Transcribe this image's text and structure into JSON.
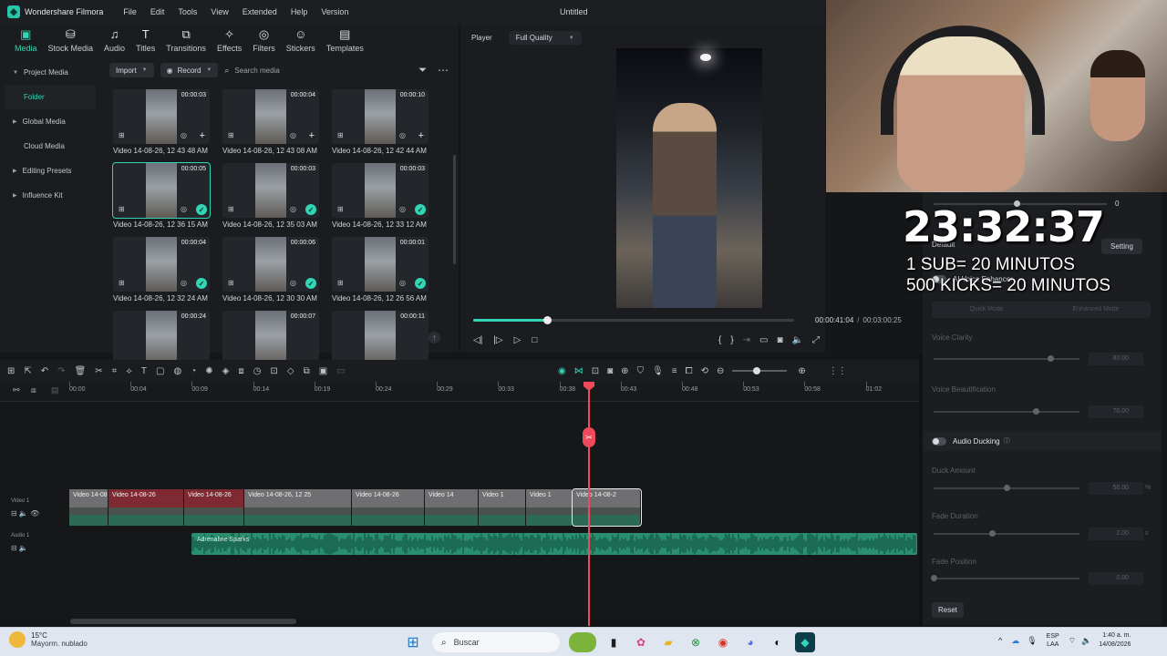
{
  "app": {
    "name": "Wondershare Filmora",
    "title": "Untitled"
  },
  "menu": [
    "File",
    "Edit",
    "Tools",
    "View",
    "Extended",
    "Help",
    "Version"
  ],
  "tabs": [
    {
      "label": "Media",
      "icon": "media-icon"
    },
    {
      "label": "Stock Media",
      "icon": "stock-media-icon"
    },
    {
      "label": "Audio",
      "icon": "audio-icon"
    },
    {
      "label": "Titles",
      "icon": "titles-icon"
    },
    {
      "label": "Transitions",
      "icon": "transitions-icon"
    },
    {
      "label": "Effects",
      "icon": "effects-icon"
    },
    {
      "label": "Filters",
      "icon": "filters-icon"
    },
    {
      "label": "Stickers",
      "icon": "stickers-icon"
    },
    {
      "label": "Templates",
      "icon": "templates-icon"
    }
  ],
  "sidebar": {
    "project_media": "Project Media",
    "folder": "Folder",
    "global_media": "Global Media",
    "cloud_media": "Cloud Media",
    "editing_presets": "Editing Presets",
    "influence_kit": "Influence Kit"
  },
  "media_toolbar": {
    "import": "Import",
    "record": "Record",
    "search_placeholder": "Search media"
  },
  "media": [
    {
      "label": "Video 14-08-26, 12 43 48 AM",
      "duration": "00:00:03",
      "state": "add",
      "selected": false
    },
    {
      "label": "Video 14-08-26, 12 43 08 AM",
      "duration": "00:00:04",
      "state": "add",
      "selected": false
    },
    {
      "label": "Video 14-08-26, 12 42 44 AM",
      "duration": "00:00:10",
      "state": "add",
      "selected": false
    },
    {
      "label": "Video 14-08-26, 12 36 15 AM",
      "duration": "00:00:05",
      "state": "check",
      "selected": true
    },
    {
      "label": "Video 14-08-26, 12 35 03 AM",
      "duration": "00:00:03",
      "state": "check",
      "selected": false
    },
    {
      "label": "Video 14-08-26, 12 33 12 AM",
      "duration": "00:00:03",
      "state": "check",
      "selected": false
    },
    {
      "label": "Video 14-08-26, 12 32 24 AM",
      "duration": "00:00:04",
      "state": "check",
      "selected": false
    },
    {
      "label": "Video 14-08-26, 12 30 30 AM",
      "duration": "00:00:06",
      "state": "check",
      "selected": false
    },
    {
      "label": "Video 14-08-26, 12 26 56 AM",
      "duration": "00:00:01",
      "state": "check",
      "selected": false
    },
    {
      "label": "",
      "duration": "00:00:24",
      "state": "none",
      "selected": false
    },
    {
      "label": "",
      "duration": "00:00:07",
      "state": "none",
      "selected": false
    },
    {
      "label": "",
      "duration": "00:00:11",
      "state": "none",
      "selected": false
    }
  ],
  "player": {
    "label": "Player",
    "quality": "Full Quality",
    "current_time": "00:00:41:04",
    "total_time": "00:03:00:25",
    "progress": 0.23
  },
  "overlay": {
    "clock": "23:32:37",
    "line1": "1 SUB= 20 MINUTOS",
    "line2": "500 KICKS= 20 MINUTOS"
  },
  "props": {
    "value_top": "0",
    "preset": "Default",
    "setting": "Setting",
    "ai_voice_enhancer": "AI Voice Enhancer",
    "quick_mode": "Quick Mode",
    "enhanced_mode": "Enhanced Mode",
    "voice_clarity": {
      "label": "Voice Clarity",
      "value": "80.00",
      "level": 0.8
    },
    "voice_beautification": {
      "label": "Voice Beautification",
      "value": "70.00",
      "level": 0.7
    },
    "audio_ducking": "Audio Ducking",
    "duck_amount": {
      "label": "Duck Amount",
      "value": "50.00",
      "unit": "%",
      "level": 0.5
    },
    "fade_duration": {
      "label": "Fade Duration",
      "value": "2.00",
      "unit": "s",
      "level": 0.4
    },
    "fade_position": {
      "label": "Fade Position",
      "value": "0.00",
      "level": 0.0
    },
    "reset": "Reset"
  },
  "timeline": {
    "ruler": [
      "00:00",
      "00:04",
      "00:09",
      "00:14",
      "00:19",
      "00:24",
      "00:29",
      "00:33",
      "00:38",
      "00:43",
      "00:48",
      "00:53",
      "00:58",
      "01:02"
    ],
    "video_track": "Video 1",
    "audio_track": "Audio 1",
    "clips": [
      {
        "label": "Video 14-08-26",
        "red": false
      },
      {
        "label": "Video 14-08-26",
        "red": true
      },
      {
        "label": "Video 14-08-26",
        "red": true
      },
      {
        "label": "Video 14-08-26, 12 25",
        "red": false
      },
      {
        "label": "Video 14-08-26",
        "red": false
      },
      {
        "label": "Video 14",
        "red": false
      },
      {
        "label": "Video 1",
        "red": false
      },
      {
        "label": "Video 1",
        "red": false
      },
      {
        "label": "Video 14-08-2",
        "red": false
      }
    ],
    "audio_label": "Adrenaline Sparks"
  },
  "taskbar": {
    "weather_temp": "15°C",
    "weather_desc": "Mayorm. nublado",
    "search": "Buscar",
    "lang1": "ESP",
    "lang2": "LAA",
    "time": "1:40 a. m.",
    "date": "14/08/2026"
  }
}
